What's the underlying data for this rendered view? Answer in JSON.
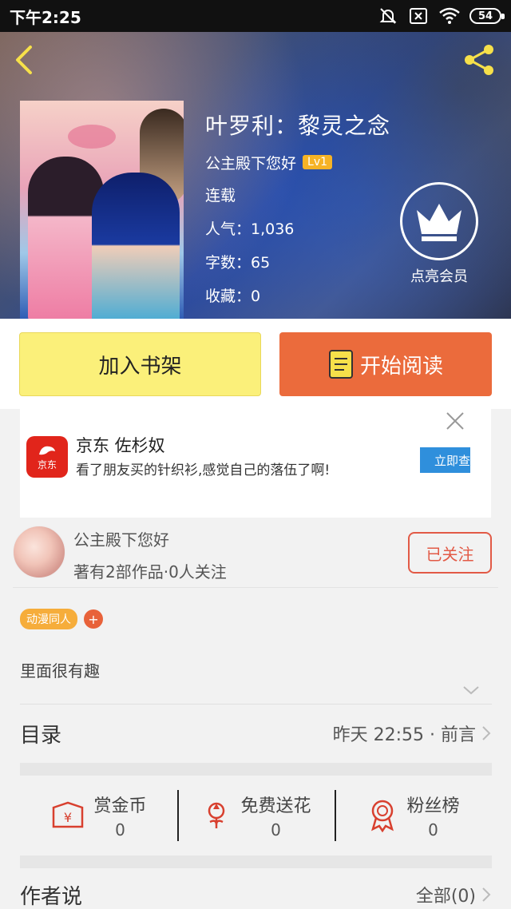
{
  "status_bar": {
    "time": "下午2:25",
    "battery": "54"
  },
  "book": {
    "title": "叶罗利：黎灵之念",
    "author": "公主殿下您好",
    "level": "Lv1",
    "status": "连载",
    "popularity": "人气：1,036",
    "word_count": "字数：65",
    "favorites": "收藏：0"
  },
  "vip": {
    "label": "点亮会员"
  },
  "actions": {
    "add_shelf": "加入书架",
    "start_read": "开始阅读"
  },
  "ad": {
    "logo_text": "京东",
    "title": "京东 佐杉奴",
    "description": "看了朋友买的针织衫,感觉自己的落伍了啊!",
    "cta": "立即查看"
  },
  "author_block": {
    "name": "公主殿下您好",
    "stats": "著有2部作品·0人关注",
    "follow_label": "已关注"
  },
  "tags": [
    "动漫同人"
  ],
  "tag_add": "+",
  "intro": "里面很有趣",
  "toc": {
    "label": "目录",
    "meta": "昨天 22:55 · 前言"
  },
  "rewards": [
    {
      "label": "赏金币",
      "count": "0",
      "icon": "coin-envelope-icon"
    },
    {
      "label": "免费送花",
      "count": "0",
      "icon": "flower-icon"
    },
    {
      "label": "粉丝榜",
      "count": "0",
      "icon": "medal-icon"
    }
  ],
  "author_says": {
    "label": "作者说",
    "all": "全部(0)"
  },
  "colors": {
    "accent_orange": "#eb6b3c",
    "shelf_yellow": "#fbf07a",
    "follow_red": "#e25a46",
    "tag_orange": "#f6ad3b"
  }
}
